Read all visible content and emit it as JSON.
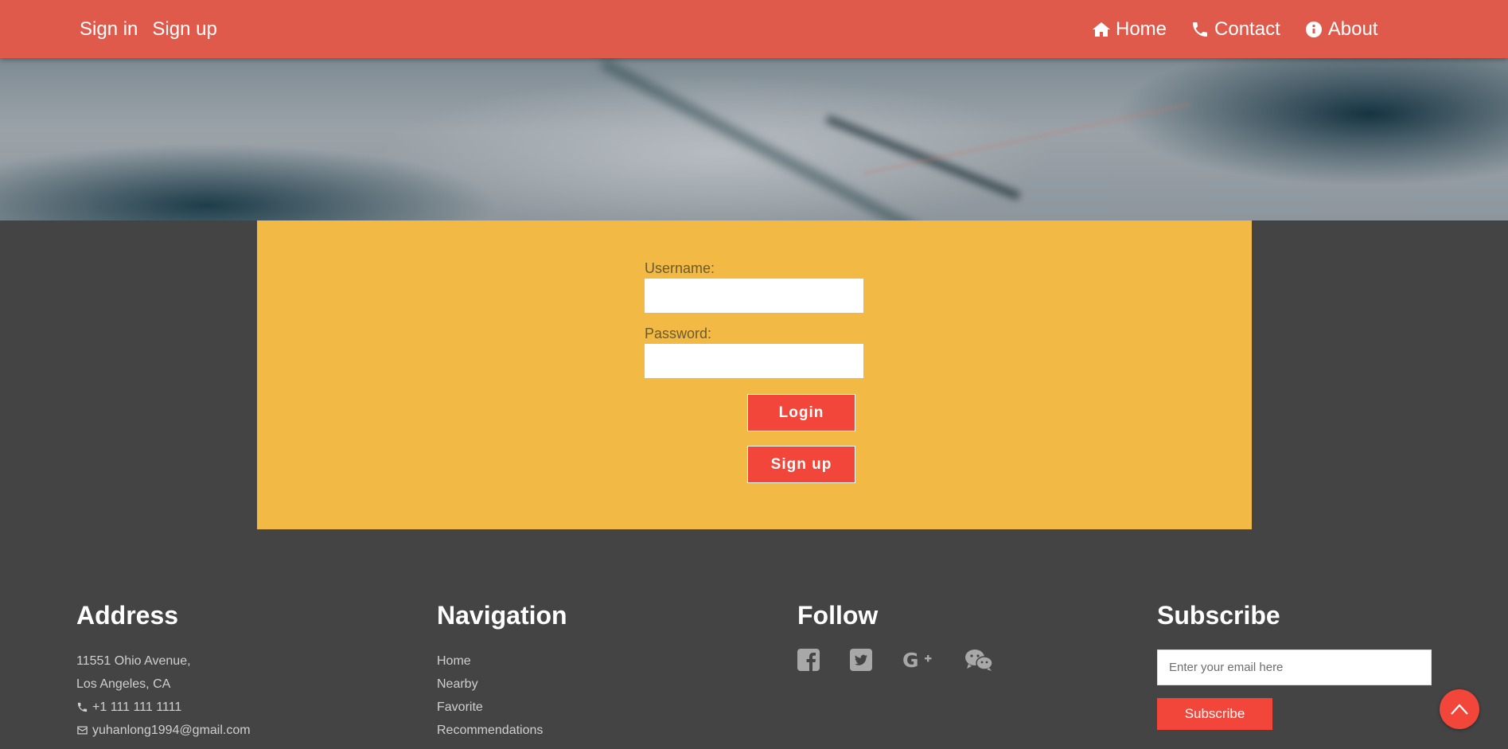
{
  "nav": {
    "sign_in": "Sign in",
    "sign_up": "Sign up",
    "home": "Home",
    "contact": "Contact",
    "about": "About",
    "home_icon": "home-icon",
    "contact_icon": "phone-icon",
    "about_icon": "info-icon"
  },
  "login_form": {
    "username_label": "Username:",
    "username_value": "",
    "password_label": "Password:",
    "password_value": "",
    "login_button": "Login",
    "signup_button": "Sign up"
  },
  "footer": {
    "address": {
      "heading": "Address",
      "line1": "11551 Ohio Avenue,",
      "line2": "Los Angeles, CA",
      "phone": "+1 111 111 1111",
      "email": "yuhanlong1994@gmail.com"
    },
    "navigation": {
      "heading": "Navigation",
      "items": [
        "Home",
        "Nearby",
        "Favorite",
        "Recommendations"
      ]
    },
    "follow": {
      "heading": "Follow",
      "icons": [
        "facebook-icon",
        "twitter-icon",
        "google-plus-icon",
        "wechat-icon"
      ]
    },
    "subscribe": {
      "heading": "Subscribe",
      "placeholder": "Enter your email here",
      "button": "Subscribe"
    }
  },
  "colors": {
    "nav_bg": "#e05a4c",
    "panel_bg": "#f2ba45",
    "button_red": "#f2463a",
    "page_bg": "#444444"
  }
}
